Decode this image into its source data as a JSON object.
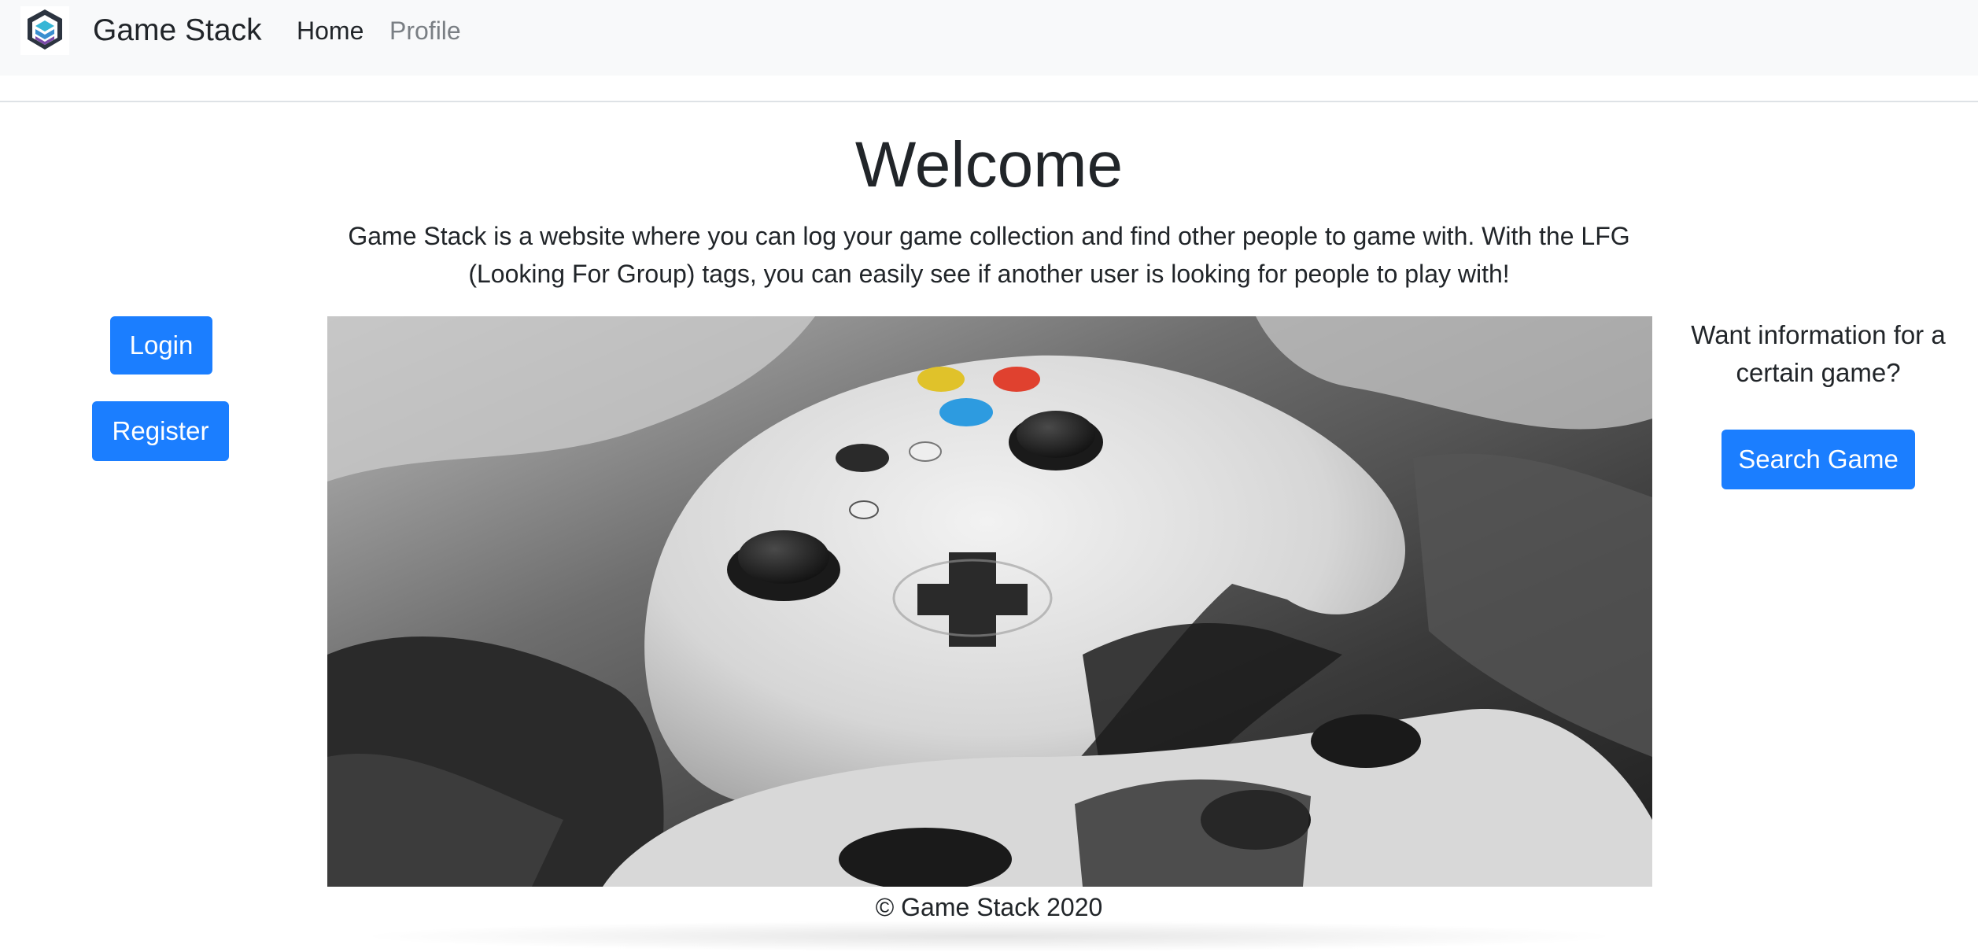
{
  "nav": {
    "brand": "Game Stack",
    "links": [
      {
        "label": "Home"
      },
      {
        "label": "Profile"
      }
    ]
  },
  "main": {
    "title": "Welcome",
    "intro": "Game Stack is a website where you can log your game collection and find other people to game with. With the LFG (Looking For Group) tags, you can easily see if another user is looking for people to play with!"
  },
  "auth": {
    "login_label": "Login",
    "register_label": "Register"
  },
  "search": {
    "prompt": "Want information for a certain game?",
    "button_label": "Search Game"
  },
  "footer": {
    "text": "© Game Stack 2020"
  },
  "colors": {
    "primary": "#1b7eff",
    "navbar_bg": "#f8f9fa",
    "text": "#212529",
    "muted_link": "#7a7f84"
  },
  "icons": {
    "logo": "stacked-hexagon-logo-icon"
  }
}
